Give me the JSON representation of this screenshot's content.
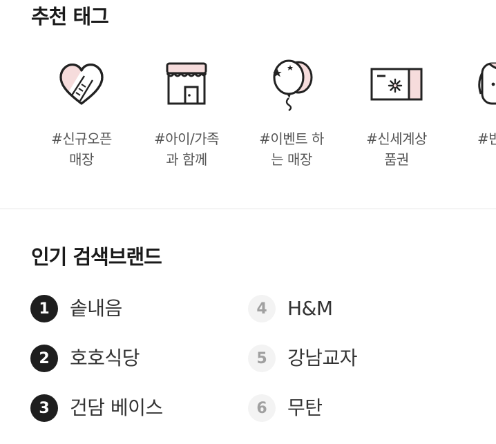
{
  "recommended": {
    "title": "추천 태그",
    "tags": [
      {
        "icon": "heart-bandage-icon",
        "label": "#신규오픈\n매장"
      },
      {
        "icon": "storefront-icon",
        "label": "#아이/가족\n과 함께"
      },
      {
        "icon": "balloons-icon",
        "label": "#이벤트 하\n는 매장"
      },
      {
        "icon": "gift-voucher-icon",
        "label": "#신세계상\n품권"
      },
      {
        "icon": "pet-face-icon",
        "label": "#반려견"
      }
    ]
  },
  "popular": {
    "title": "인기 검색브랜드",
    "left": [
      {
        "rank": "1",
        "name": "솥내음"
      },
      {
        "rank": "2",
        "name": "호호식당"
      },
      {
        "rank": "3",
        "name": "건담 베이스"
      }
    ],
    "right": [
      {
        "rank": "4",
        "name": "H&M"
      },
      {
        "rank": "5",
        "name": "강남교자"
      },
      {
        "rank": "6",
        "name": "무탄"
      }
    ]
  },
  "colors": {
    "accent_pink": "#f6dcdc",
    "outline": "#222222",
    "rank_top_bg": "#1e1e1e",
    "rank_rest_bg": "#f3f3f3"
  }
}
